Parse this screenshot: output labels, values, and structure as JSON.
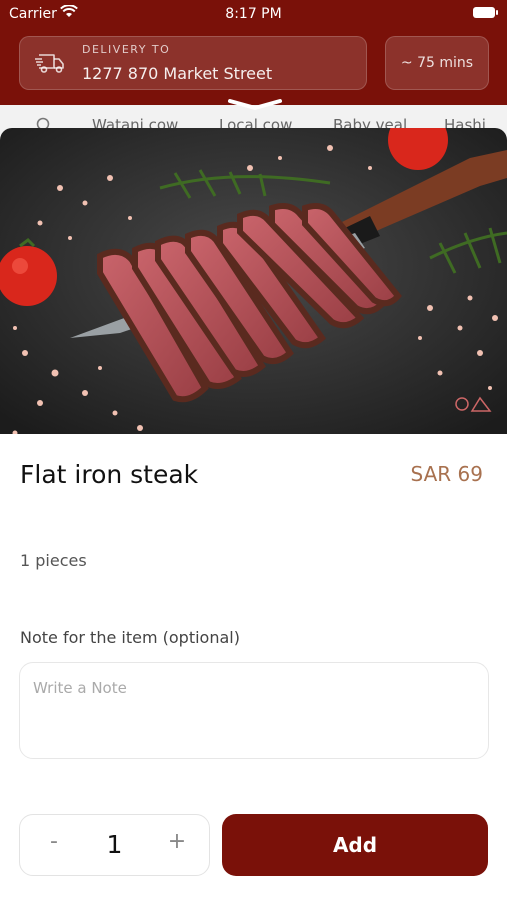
{
  "status_bar": {
    "carrier": "Carrier",
    "time": "8:17 PM"
  },
  "header": {
    "delivery_label": "DELIVERY TO",
    "address": "1277 870 Market Street",
    "eta": "~ 75 mins"
  },
  "categories": [
    "Watani cow",
    "Local cow",
    "Baby veal",
    "Hashi"
  ],
  "product": {
    "name": "Flat iron steak",
    "price": "SAR 69",
    "pieces": "1 pieces",
    "note_label": "Note for the item (optional)",
    "note_placeholder": "Write a Note",
    "quantity": "1"
  },
  "actions": {
    "minus": "-",
    "plus": "+",
    "add": "Add"
  },
  "colors": {
    "brand": "#7a1109",
    "price": "#a8714f"
  }
}
